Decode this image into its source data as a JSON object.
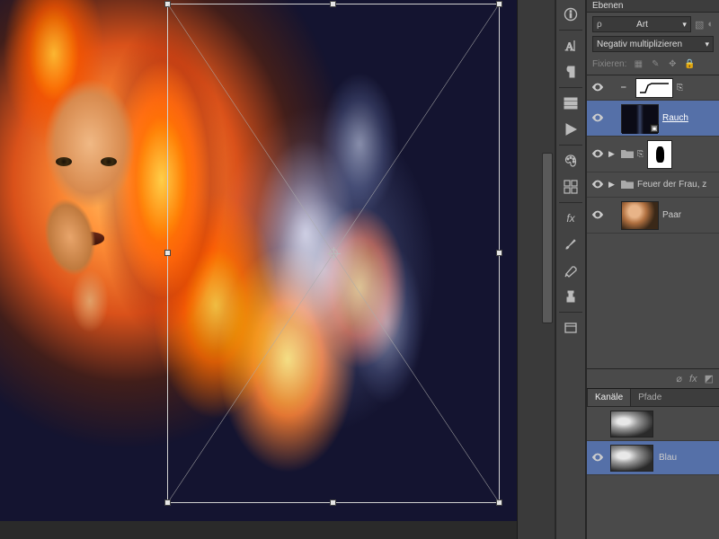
{
  "panels": {
    "layers_title": "Ebenen",
    "blend_mode_dropdown": "Negativ multiplizieren",
    "kind_filter_label": "Art",
    "lock_label": "Fixieren:"
  },
  "layers": [
    {
      "name": "",
      "type": "adjustment",
      "visible": true
    },
    {
      "name": "Rauch",
      "type": "smart-object",
      "visible": true,
      "selected": true
    },
    {
      "name": "",
      "type": "group-masked",
      "visible": true,
      "folded": true
    },
    {
      "name": "Feuer der Frau, z",
      "type": "group",
      "visible": true,
      "folded": true
    },
    {
      "name": "Paar",
      "type": "image",
      "visible": true
    }
  ],
  "channels": {
    "tab_channels": "Kanäle",
    "tab_paths": "Pfade",
    "rows": [
      {
        "name": "",
        "selected": false
      },
      {
        "name": "Blau",
        "selected": true
      }
    ]
  },
  "mid_tool_labels": {
    "info": "info",
    "type": "type",
    "paragraph": "paragraph",
    "histogram": "histogram",
    "play": "play",
    "swatches": "swatches",
    "grid": "grid",
    "fx": "fx",
    "brush": "brush",
    "stamp": "stamp",
    "ruler": "ruler",
    "note": "note"
  },
  "footer_icons": {
    "link": "link",
    "fx": "fx",
    "mask": "mask"
  }
}
